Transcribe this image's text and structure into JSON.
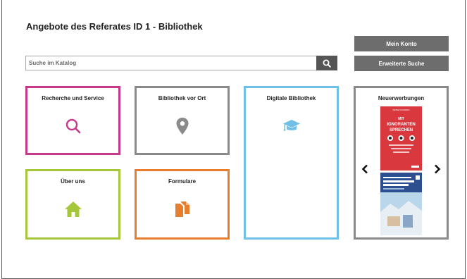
{
  "header": {
    "title": "Angebote des Referates ID 1 - Bibliothek"
  },
  "account": {
    "my_account_label": "Mein Konto",
    "advanced_search_label": "Erweiterte Suche"
  },
  "search": {
    "placeholder": "Suche im Katalog",
    "value": "",
    "icon": "search-icon"
  },
  "tiles": [
    {
      "label": "Recherche und Service",
      "icon": "search-icon",
      "color": "#c6398a"
    },
    {
      "label": "Bibliothek vor Ort",
      "icon": "map-pin-icon",
      "color": "#8a8a8a"
    },
    {
      "label": "Digitale Bibliothek",
      "icon": "graduation-cap-icon",
      "color": "#6fbfe6"
    },
    {
      "label": "Neuerwerbungen",
      "icon": "book-carousel",
      "color": "#8a8a8a"
    },
    {
      "label": "Über uns",
      "icon": "home-icon",
      "color": "#a6c73c"
    },
    {
      "label": "Formulare",
      "icon": "documents-icon",
      "color": "#e67e2e"
    }
  ],
  "new_acquisitions": {
    "books": [
      {
        "cover_title": "MIT IGNORANTEN SPRECHEN",
        "cover_color": "#d9393e"
      },
      {
        "cover_title": "EU's Common Foreign and Security Policy",
        "cover_color": "#b9d6ea"
      }
    ],
    "prev_icon": "chevron-left-icon",
    "next_icon": "chevron-right-icon"
  }
}
